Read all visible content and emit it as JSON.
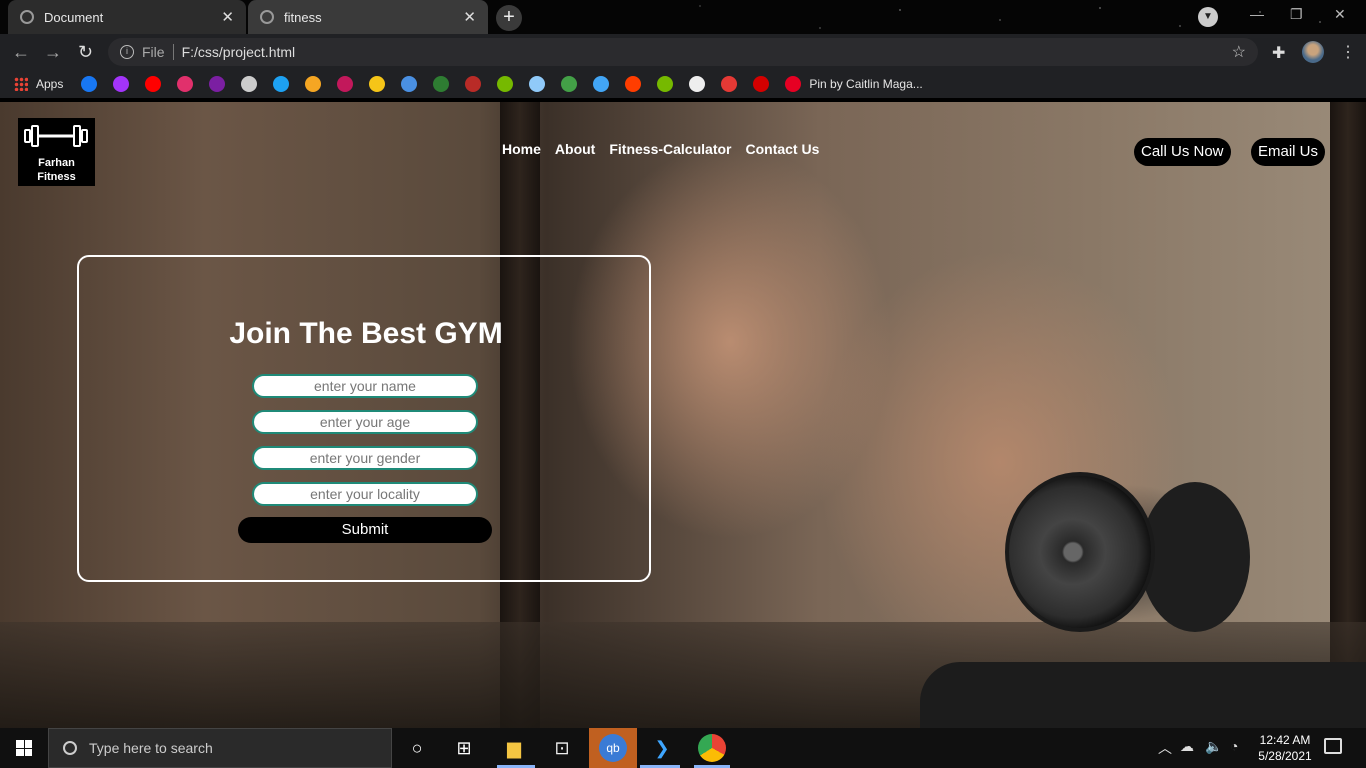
{
  "browser": {
    "tabs": [
      {
        "title": "Document",
        "close": "✕"
      },
      {
        "title": "fitness",
        "close": "✕"
      }
    ],
    "new_tab": "+",
    "url_protocol": "File",
    "url": "F:/css/project.html",
    "bookmarks": {
      "apps_label": "Apps",
      "last_label": "Pin by Caitlin Maga...",
      "icons": [
        {
          "name": "facebook-icon",
          "color": "#1877f2"
        },
        {
          "name": "messenger-icon",
          "color": "#a334fa"
        },
        {
          "name": "youtube-icon",
          "color": "#ff0000"
        },
        {
          "name": "instagram-icon",
          "color": "#e1306c"
        },
        {
          "name": "bookmark-icon-5",
          "color": "#7b1fa2"
        },
        {
          "name": "bookmark-icon-6",
          "color": "#cccccc"
        },
        {
          "name": "twitter-icon",
          "color": "#1da1f2"
        },
        {
          "name": "bookmark-icon-8",
          "color": "#f5a623"
        },
        {
          "name": "bookmark-icon-9",
          "color": "#c2185b"
        },
        {
          "name": "imdb-icon",
          "color": "#f5c518"
        },
        {
          "name": "bookmark-icon-11",
          "color": "#4a90e2"
        },
        {
          "name": "bookmark-icon-12",
          "color": "#2e7d32"
        },
        {
          "name": "quora-icon",
          "color": "#b92b27"
        },
        {
          "name": "bookmark-icon-14",
          "color": "#76b900"
        },
        {
          "name": "bookmark-icon-15",
          "color": "#90caf9"
        },
        {
          "name": "bookmark-icon-16",
          "color": "#43a047"
        },
        {
          "name": "bookmark-icon-17",
          "color": "#42a5f5"
        },
        {
          "name": "bookmark-icon-18",
          "color": "#ff3d00"
        },
        {
          "name": "bookmark-icon-19",
          "color": "#76b900"
        },
        {
          "name": "bookmark-icon-20",
          "color": "#eeeeee"
        },
        {
          "name": "bookmark-icon-21",
          "color": "#e53935"
        },
        {
          "name": "bookmark-icon-22",
          "color": "#d50000"
        },
        {
          "name": "pinterest-icon",
          "color": "#e60023"
        }
      ]
    }
  },
  "site": {
    "logo": {
      "line1": "Farhan",
      "line2": "Fitness"
    },
    "nav": [
      "Home",
      "About",
      "Fitness-Calculator",
      "Contact Us"
    ],
    "call_button": "Call Us Now",
    "email_button": "Email Us",
    "form": {
      "title": "Join The Best GYM",
      "name_placeholder": "enter your name",
      "age_placeholder": "enter your age",
      "gender_placeholder": "enter your gender",
      "locality_placeholder": "enter your locality",
      "submit_label": "Submit",
      "field_border_color": "#1f8a78"
    }
  },
  "taskbar": {
    "search_placeholder": "Type here to search",
    "time": "12:42 AM",
    "date": "5/28/2021"
  }
}
